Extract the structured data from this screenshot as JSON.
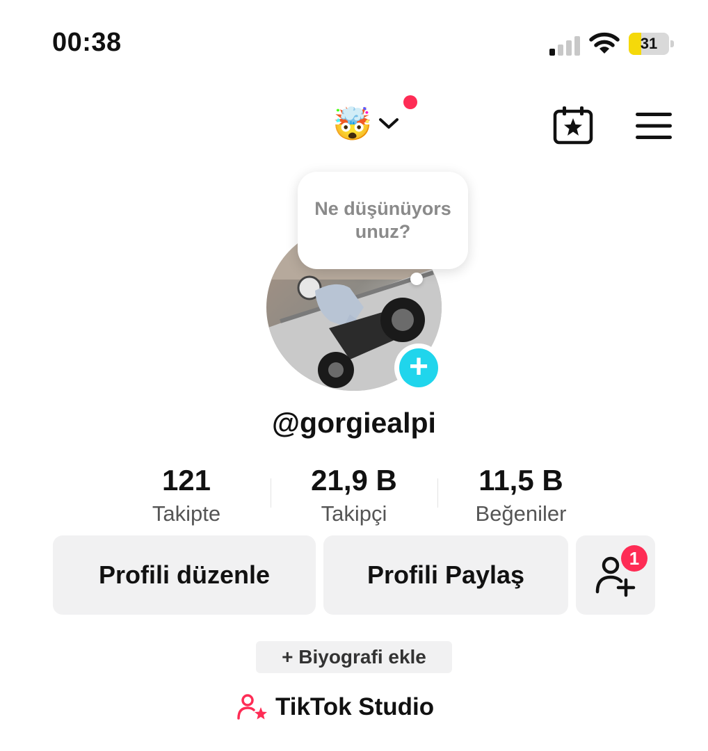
{
  "status_bar": {
    "time": "00:38",
    "battery": "31",
    "battery_level": 0.31
  },
  "header": {
    "emoji": "🤯",
    "has_notification": true
  },
  "note_bubble": {
    "text": "Ne düşünüyorsunuz?"
  },
  "profile": {
    "username": "@gorgiealpi"
  },
  "stats": [
    {
      "value": "121",
      "label": "Takipte"
    },
    {
      "value": "21,9 B",
      "label": "Takipçi"
    },
    {
      "value": "11,5 B",
      "label": "Beğeniler"
    }
  ],
  "actions": {
    "edit_profile": "Profili düzenle",
    "share_profile": "Profili Paylaş",
    "friend_requests_count": "1"
  },
  "bio": {
    "add_label": "+ Biyografi ekle"
  },
  "studio": {
    "label": "TikTok Studio"
  },
  "icons": {
    "calendar": "calendar-star-icon",
    "menu": "hamburger-menu-icon",
    "add_friend": "person-plus-icon",
    "studio": "person-star-icon",
    "chevron": "chevron-down-icon"
  },
  "colors": {
    "accent": "#fe2c55",
    "plus_badge": "#20d5ec",
    "button_bg": "#f1f1f2",
    "battery": "#f5d90a"
  }
}
